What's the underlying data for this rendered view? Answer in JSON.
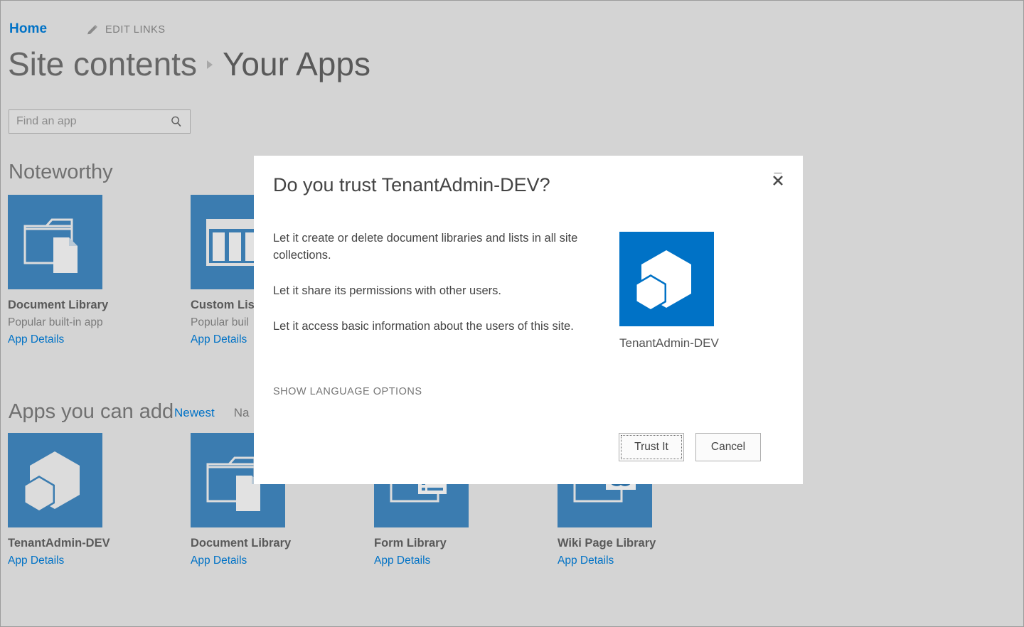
{
  "topbar": {
    "home_label": "Home",
    "edit_links_label": "EDIT LINKS"
  },
  "page_title": {
    "parent": "Site contents",
    "current": "Your Apps"
  },
  "search": {
    "placeholder": "Find an app",
    "value": ""
  },
  "sections": {
    "noteworthy_heading": "Noteworthy",
    "addable_heading": "Apps you can add"
  },
  "sort_links": [
    {
      "label": "Newest",
      "active": true
    },
    {
      "label": "Na",
      "active": false
    }
  ],
  "noteworthy_apps": [
    {
      "name": "Document Library",
      "subtitle": "Popular built-in app",
      "details_label": "App Details",
      "icon": "document-library-icon"
    },
    {
      "name": "Custom Lis",
      "subtitle": "Popular buil",
      "details_label": "App Details",
      "icon": "custom-list-icon"
    }
  ],
  "addable_apps": [
    {
      "name": "TenantAdmin-DEV",
      "subtitle": "",
      "details_label": "App Details",
      "icon": "tenantadmin-hexagon-icon"
    },
    {
      "name": "Document Library",
      "subtitle": "",
      "details_label": "App Details",
      "icon": "document-library-icon"
    },
    {
      "name": "Form Library",
      "subtitle": "",
      "details_label": "App Details",
      "icon": "form-library-icon"
    },
    {
      "name": "Wiki Page Library",
      "subtitle": "",
      "details_label": "App Details",
      "icon": "wiki-page-library-icon"
    }
  ],
  "dialog": {
    "title": "Do you trust TenantAdmin-DEV?",
    "permissions": [
      "Let it create or delete document libraries and lists in all site collections.",
      "Let it share its permissions with other users.",
      "Let it access basic information about the users of this site."
    ],
    "language_options_label": "SHOW LANGUAGE OPTIONS",
    "app_name": "TenantAdmin-DEV",
    "app_icon": "tenantadmin-hexagon-icon",
    "trust_button_label": "Trust It",
    "cancel_button_label": "Cancel",
    "close_icon": "close-icon"
  },
  "colors": {
    "page_background": "#d4d4d4",
    "tile_blue": "#3b7cb0",
    "brand_blue": "#0072c6",
    "link_blue": "#0072c6",
    "dialog_background": "#ffffff"
  }
}
